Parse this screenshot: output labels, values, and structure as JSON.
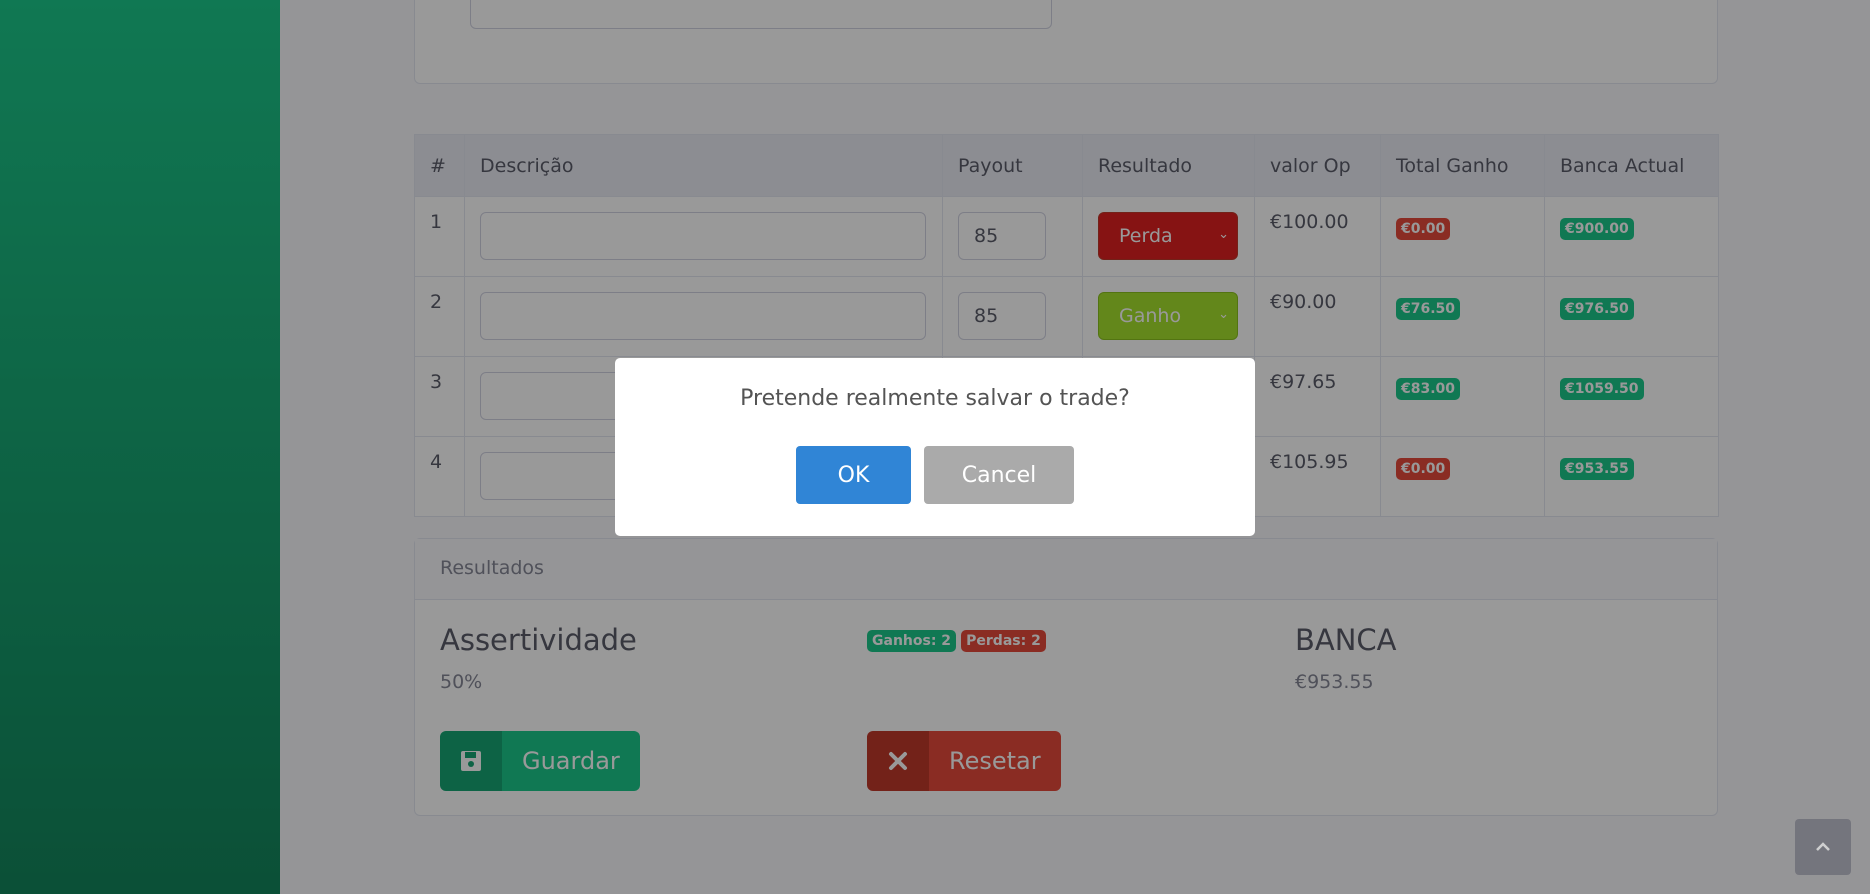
{
  "table": {
    "headers": [
      "#",
      "Descrição",
      "Payout",
      "Resultado",
      "valor Op",
      "Total Ganho",
      "Banca Actual"
    ],
    "rows": [
      {
        "num": "1",
        "payout": "85",
        "resultado": "Perda",
        "valor_op": "€100.00",
        "total_ganho": "€0.00",
        "banca_actual": "€900.00"
      },
      {
        "num": "2",
        "payout": "85",
        "resultado": "Ganho",
        "valor_op": "€90.00",
        "total_ganho": "€76.50",
        "banca_actual": "€976.50"
      },
      {
        "num": "3",
        "payout": "",
        "resultado": "",
        "valor_op": "€97.65",
        "total_ganho": "€83.00",
        "banca_actual": "€1059.50"
      },
      {
        "num": "4",
        "payout": "",
        "resultado": "",
        "valor_op": "€105.95",
        "total_ganho": "€0.00",
        "banca_actual": "€953.55"
      }
    ]
  },
  "results": {
    "header": "Resultados",
    "assertividade_title": "Assertividade",
    "assertividade_value": "50%",
    "ganhos_badge": "Ganhos: 2",
    "perdas_badge": "Perdas: 2",
    "banca_title": "BANCA",
    "banca_value": "€953.55",
    "save_label": "Guardar",
    "reset_label": "Resetar"
  },
  "modal": {
    "message": "Pretende realmente salvar o trade?",
    "ok_label": "OK",
    "cancel_label": "Cancel"
  },
  "icons": {
    "save": "floppy-disk-icon",
    "reset": "x-icon",
    "scroll_top": "chevron-up-icon",
    "select": "chevron-down-icon"
  },
  "colors": {
    "sidebar": "#1cc88a",
    "success": "#1cc88a",
    "danger": "#e74a3b",
    "perda": "#e02020",
    "ganho": "#a6e22e",
    "ok": "#3085d6",
    "cancel": "#aaaaaa"
  }
}
